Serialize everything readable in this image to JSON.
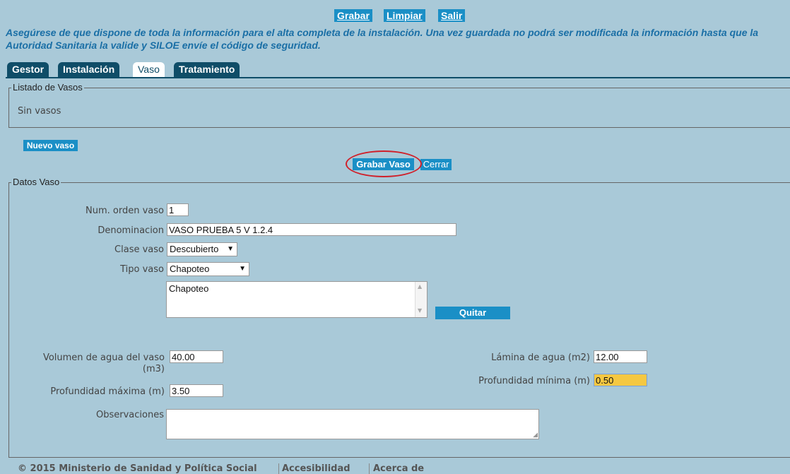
{
  "toolbar": {
    "save": "Grabar",
    "clear": "Limpiar",
    "exit": "Salir"
  },
  "warning_text": "Asegúrese de que dispone de toda la información para el alta completa de la instalación. Una vez guardada no podrá ser modificada la información hasta que la Autoridad Sanitaria la valide y SILOE envíe el código de seguridad.",
  "tabs": [
    {
      "label": "Gestor",
      "active": false
    },
    {
      "label": "Instalación",
      "active": false
    },
    {
      "label": "Vaso",
      "active": true
    },
    {
      "label": "Tratamiento",
      "active": false
    }
  ],
  "listado": {
    "legend": "Listado de Vasos",
    "empty_text": "Sin vasos"
  },
  "actions": {
    "new_vaso": "Nuevo vaso",
    "save_vaso": "Grabar Vaso",
    "close": "Cerrar"
  },
  "datos": {
    "legend": "Datos Vaso",
    "num_orden_label": "Num. orden vaso",
    "num_orden_value": "1",
    "denominacion_label": "Denominacion",
    "denominacion_value": "VASO PRUEBA 5 V 1.2.4",
    "clase_label": "Clase vaso",
    "clase_value": "Descubierto",
    "tipo_label": "Tipo vaso",
    "tipo_value": "Chapoteo",
    "tipo_list_item": "Chapoteo",
    "remove_button": "Quitar",
    "volumen_label": "Volumen de agua del vaso (m3)",
    "volumen_value": "40.00",
    "lamina_label": "Lámina de agua (m2)",
    "lamina_value": "12.00",
    "prof_min_label": "Profundidad mínima (m)",
    "prof_min_value": "0.50",
    "prof_max_label": "Profundidad máxima (m)",
    "prof_max_value": "3.50",
    "observaciones_label": "Observaciones",
    "observaciones_value": ""
  },
  "footer": {
    "copyright": "© 2015 Ministerio de Sanidad y Política Social",
    "accesibilidad": "Accesibilidad",
    "acerca": "Acerca de"
  },
  "colors": {
    "background": "#a9c9d8",
    "button": "#1a8fc6",
    "tab": "#0f4d68",
    "highlight_field": "#f5c842",
    "annotation_circle": "#d0202a"
  }
}
